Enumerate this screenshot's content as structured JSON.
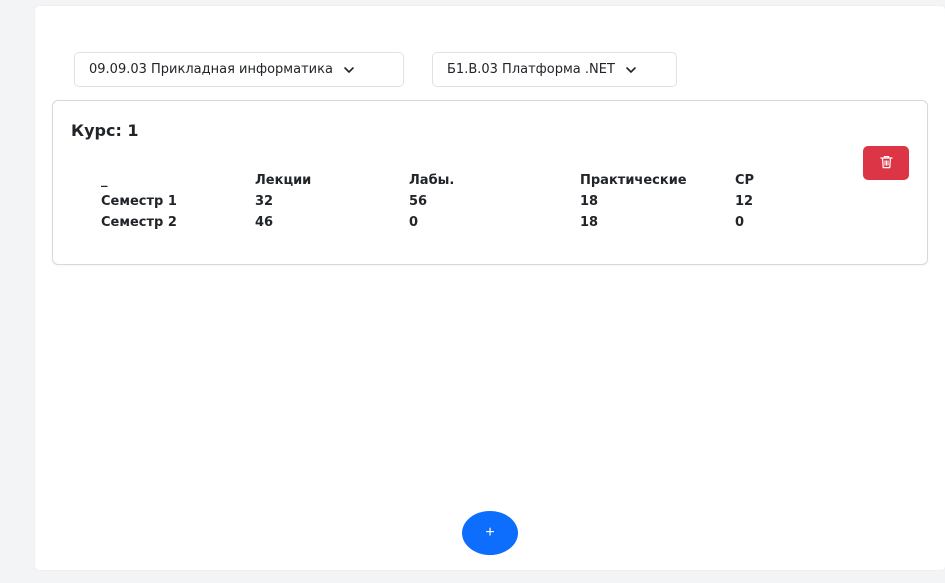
{
  "selectors": {
    "specialty": "09.09.03 Прикладная информатика",
    "discipline": "Б1.В.03 Платформа .NET"
  },
  "course": {
    "title": "Курс: 1",
    "headers": [
      "_",
      "Лекции",
      "Лабы.",
      "Практические",
      "СР"
    ],
    "rows": [
      [
        "Семестр 1",
        "32",
        "56",
        "18",
        "12"
      ],
      [
        "Семестр 2",
        "46",
        "0",
        "18",
        "0"
      ]
    ]
  },
  "buttons": {
    "delete_icon": "trash-icon",
    "add_label": "+"
  },
  "colors": {
    "danger": "#dc3545",
    "primary": "#0d6efd"
  }
}
